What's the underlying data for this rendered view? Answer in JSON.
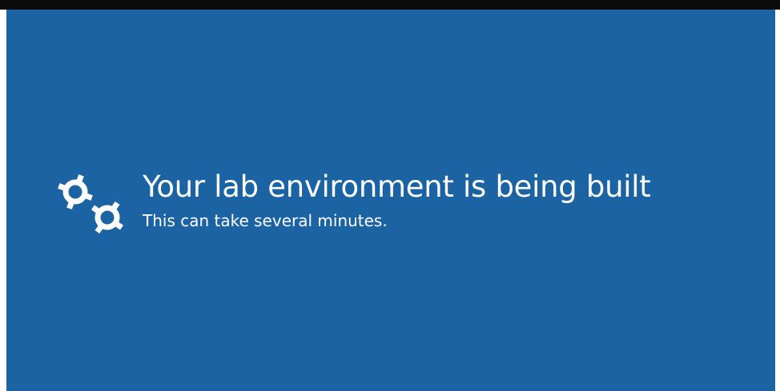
{
  "status": {
    "headline": "Your lab environment is being built",
    "message": "This can take several minutes.",
    "icon": "gears-icon"
  },
  "colors": {
    "background": "#1b63a2",
    "text": "#ffffff",
    "top_border": "#0a0a0a"
  }
}
